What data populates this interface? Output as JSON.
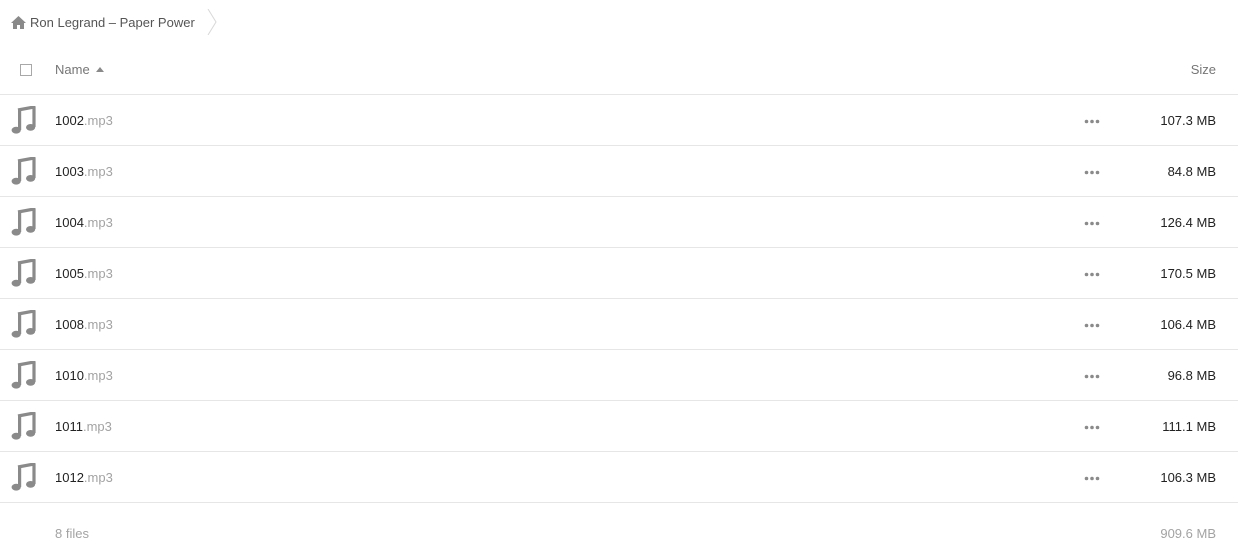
{
  "breadcrumb": {
    "home_icon": "home-icon",
    "folder_label": "Ron Legrand – Paper Power"
  },
  "header": {
    "name_label": "Name",
    "size_label": "Size",
    "sort_icon": "sort-ascending-icon"
  },
  "files": [
    {
      "base": "1002",
      "ext": ".mp3",
      "size": "107.3 MB",
      "icon": "music-note-icon"
    },
    {
      "base": "1003",
      "ext": ".mp3",
      "size": "84.8 MB",
      "icon": "music-note-icon"
    },
    {
      "base": "1004",
      "ext": ".mp3",
      "size": "126.4 MB",
      "icon": "music-note-icon"
    },
    {
      "base": "1005",
      "ext": ".mp3",
      "size": "170.5 MB",
      "icon": "music-note-icon"
    },
    {
      "base": "1008",
      "ext": ".mp3",
      "size": "106.4 MB",
      "icon": "music-note-icon"
    },
    {
      "base": "1010",
      "ext": ".mp3",
      "size": "96.8 MB",
      "icon": "music-note-icon"
    },
    {
      "base": "1011",
      "ext": ".mp3",
      "size": "111.1 MB",
      "icon": "music-note-icon"
    },
    {
      "base": "1012",
      "ext": ".mp3",
      "size": "106.3 MB",
      "icon": "music-note-icon"
    }
  ],
  "footer": {
    "count": "8 files",
    "total_size": "909.6 MB"
  },
  "colors": {
    "icon_gray": "#8a8a8a",
    "divider": "#e6e6e6",
    "muted_text": "#a3a3a3"
  }
}
